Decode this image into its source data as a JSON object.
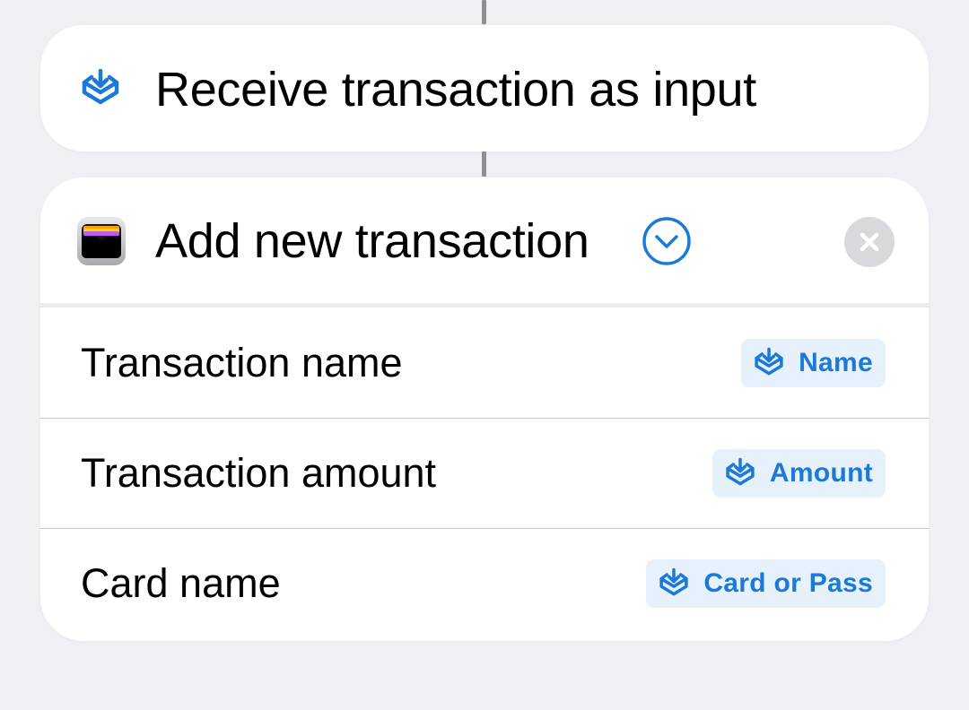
{
  "colors": {
    "accent": "#1a7ad6",
    "token_background": "#e6f1fb",
    "page_background": "#efeff4",
    "card_background": "#ffffff",
    "close_button": "#d9d9dd"
  },
  "receive_step": {
    "icon": "tray-arrow-down-icon",
    "title": "Receive transaction as input"
  },
  "action": {
    "app_icon": "wallet-app-icon",
    "title": "Add new transaction",
    "expand_icon": "chevron-down-circle-icon",
    "close_icon": "close-icon",
    "parameters": [
      {
        "label": "Transaction name",
        "token_icon": "tray-arrow-down-icon",
        "token": "Name"
      },
      {
        "label": "Transaction amount",
        "token_icon": "tray-arrow-down-icon",
        "token": "Amount"
      },
      {
        "label": "Card name",
        "token_icon": "tray-arrow-down-icon",
        "token": "Card or Pass"
      }
    ]
  }
}
